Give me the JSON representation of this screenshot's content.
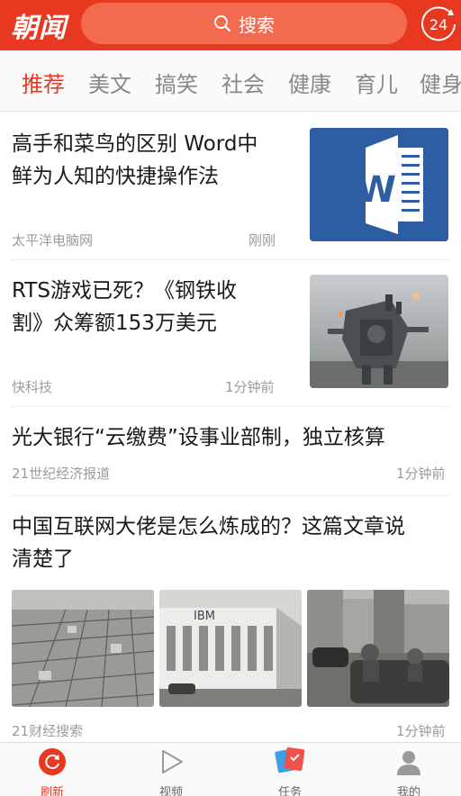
{
  "header": {
    "logo": "朝闻",
    "search_label": "搜索",
    "badge": "24"
  },
  "tabs": [
    {
      "label": "推荐",
      "active": true
    },
    {
      "label": "美文",
      "active": false
    },
    {
      "label": "搞笑",
      "active": false
    },
    {
      "label": "社会",
      "active": false
    },
    {
      "label": "健康",
      "active": false
    },
    {
      "label": "育儿",
      "active": false
    },
    {
      "label": "健身",
      "active": false
    }
  ],
  "news": [
    {
      "title_line1": "高手和菜鸟的区别 Word中",
      "title_line2": "鲜为人知的快捷操作法",
      "source": "太平洋电脑网",
      "time": "刚刚",
      "thumb_icon": "word-logo-icon"
    },
    {
      "title_line1": "RTS游戏已死？《钢铁收",
      "title_line2": "割》众筹额153万美元",
      "source": "快科技",
      "time": "1分钟前",
      "thumb_icon": "robot-mech-image"
    },
    {
      "title_line1": "光大银行“云缴费”设事业部制，独立核算",
      "source": "21世纪经济报道",
      "time": "1分钟前"
    },
    {
      "title_line1": "中国互联网大佬是怎么炼成的？这篇文章说",
      "title_line2": "清楚了",
      "source": "21财经搜索",
      "time": "1分钟前",
      "images": [
        "city-aerial-image",
        "ibm-building-image",
        "street-vintage-car-image"
      ],
      "ibm_text": "IBM"
    }
  ],
  "bottom_nav": [
    {
      "label": "刷新",
      "icon": "refresh-icon",
      "active": true
    },
    {
      "label": "视频",
      "icon": "play-icon",
      "active": false
    },
    {
      "label": "任务",
      "icon": "task-icon",
      "active": false
    },
    {
      "label": "我的",
      "icon": "profile-icon",
      "active": false
    }
  ],
  "colors": {
    "brand": "#e8381f",
    "text": "#1a1a1a",
    "meta": "#9b9b9b"
  }
}
